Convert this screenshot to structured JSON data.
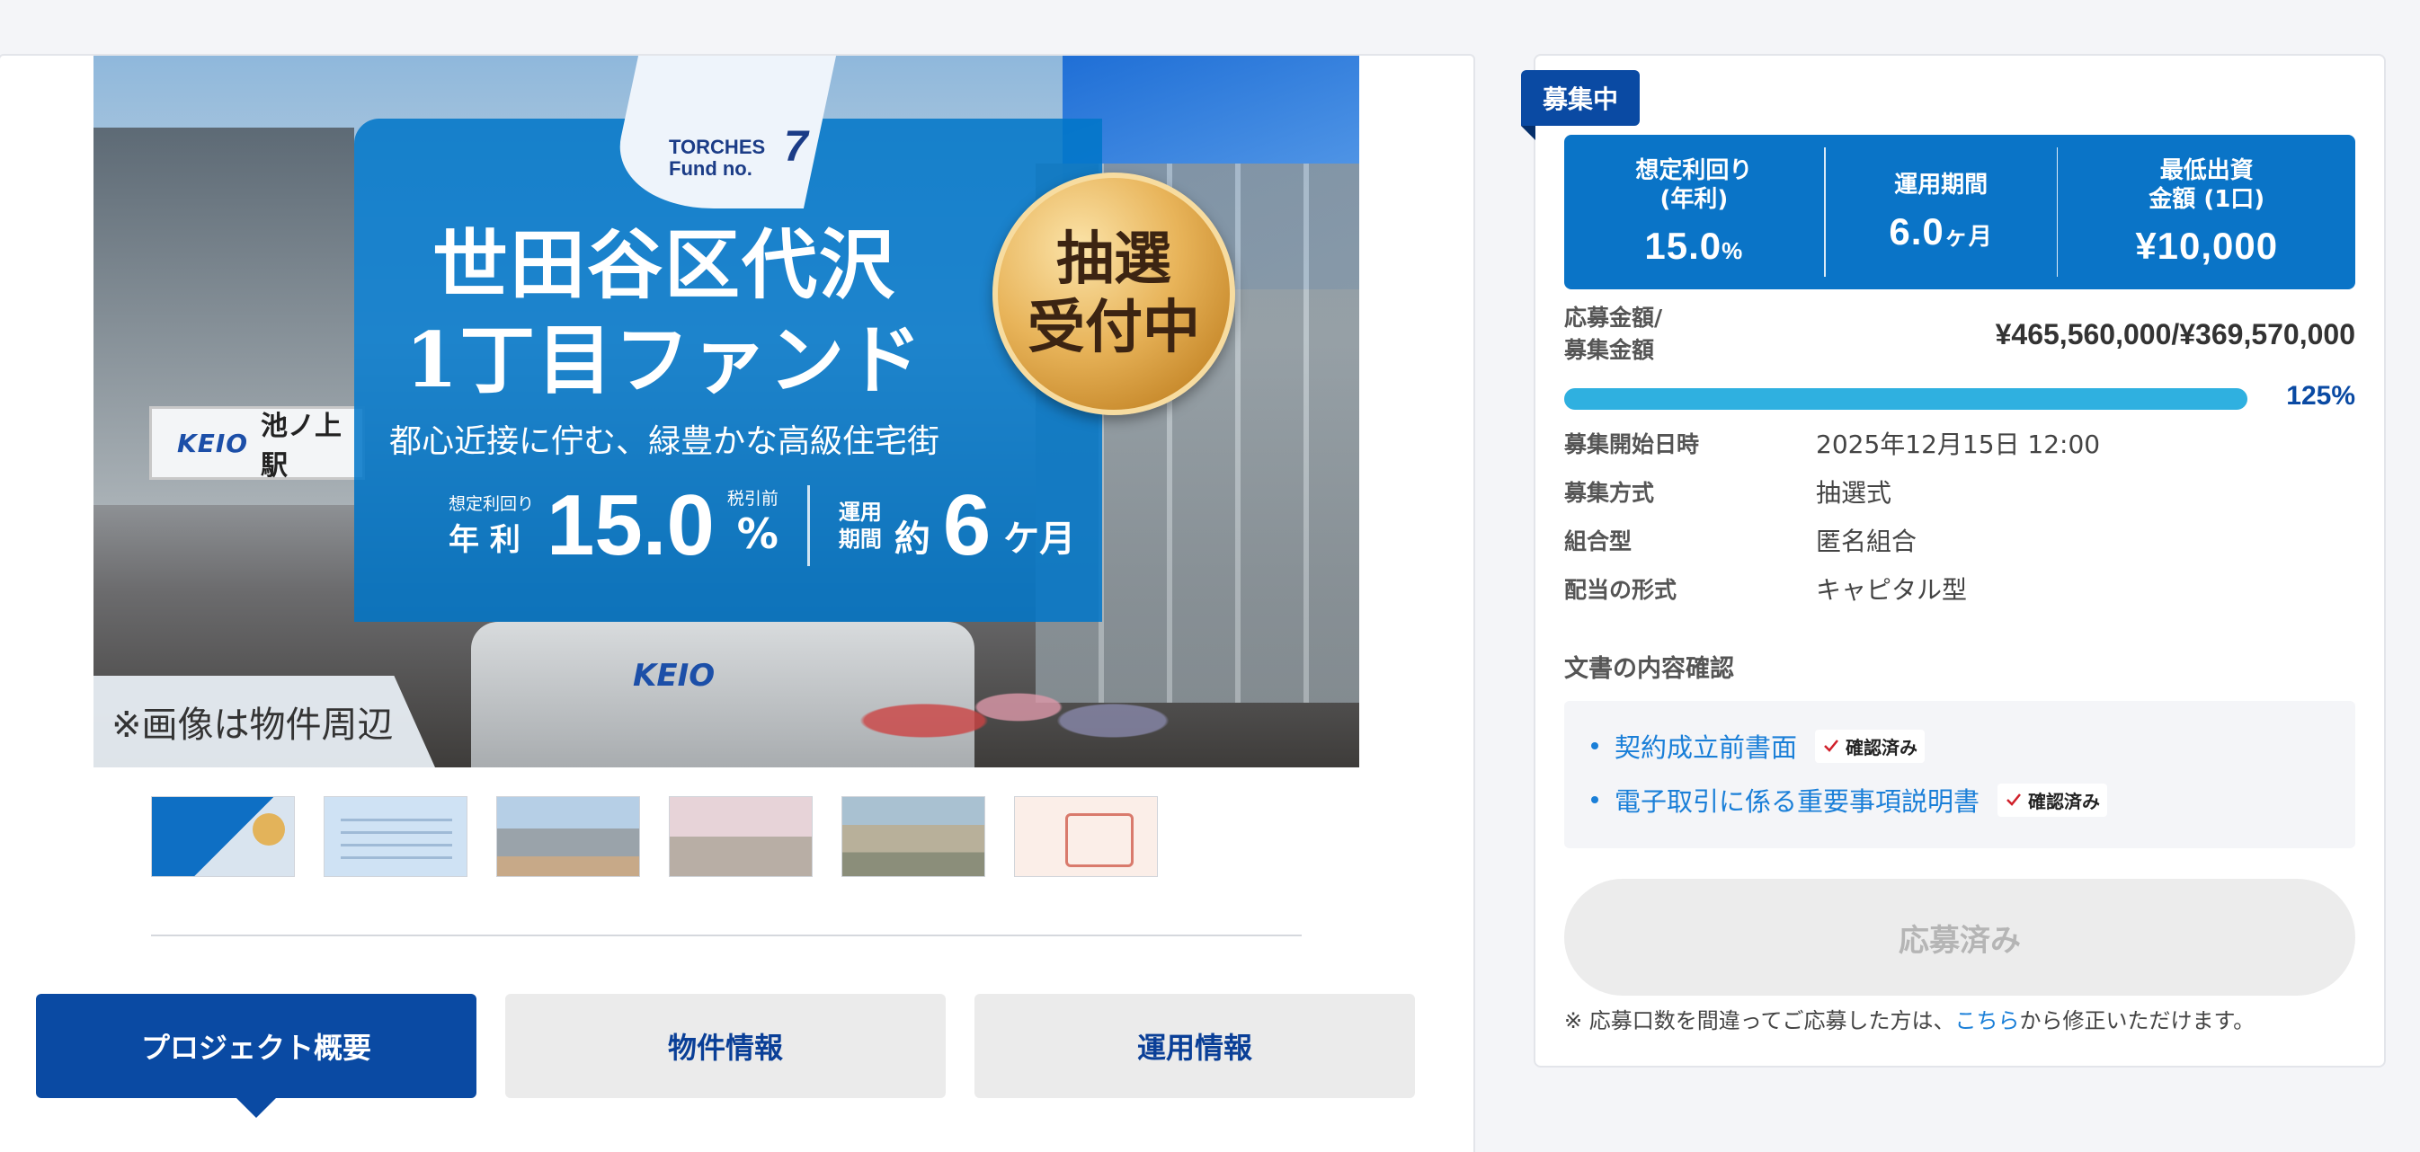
{
  "hero": {
    "fund_label_line1": "TORCHES",
    "fund_label_line2": "Fund no.",
    "fund_number": "7",
    "title_line1": "世田谷区代沢",
    "title_line2": "1丁目ファンド",
    "subtitle": "都心近接に佇む、緑豊かな高級住宅街",
    "stat1_small_label": "想定利回り",
    "stat1_big_label": "年 利",
    "stat1_value": "15.0",
    "stat1_tax_label": "税引前",
    "stat1_unit": "%",
    "stat2_label_line1": "運用",
    "stat2_label_line2": "期間",
    "stat2_prefix": "約",
    "stat2_value": "6",
    "stat2_unit": "ケ月",
    "seal_text": "抽選\n受付中",
    "station_logo": "KEIO",
    "station_name": "池ノ上駅",
    "train_logo": "KEIO",
    "caption": "※画像は物件周辺"
  },
  "thumbnails": [
    "thumb-1",
    "thumb-2",
    "thumb-3",
    "thumb-4",
    "thumb-5",
    "thumb-6"
  ],
  "tabs": [
    {
      "label": "プロジェクト概要",
      "active": true
    },
    {
      "label": "物件情報",
      "active": false
    },
    {
      "label": "運用情報",
      "active": false
    }
  ],
  "side": {
    "status_badge": "募集中",
    "stats": [
      {
        "label": "想定利回り\n(年利)",
        "value": "15.0",
        "unit": "%"
      },
      {
        "label": "運用期間",
        "value": "6.0",
        "unit": "ヶ月"
      },
      {
        "label": "最低出資\n金額 (1口)",
        "value": "¥10,000",
        "unit": ""
      }
    ],
    "amount_label": "応募金額/\n募集金額",
    "amount_value": "¥465,560,000/¥369,570,000",
    "progress_percent": 125,
    "progress_label": "125%",
    "info": [
      {
        "key": "募集開始日時",
        "value": "2025年12月15日 12:00"
      },
      {
        "key": "募集方式",
        "value": "抽選式"
      },
      {
        "key": "組合型",
        "value": "匿名組合"
      },
      {
        "key": "配当の形式",
        "value": "キャピタル型"
      }
    ],
    "docs_title": "文書の内容確認",
    "docs": [
      {
        "label": "契約成立前書面",
        "status": "確認済み"
      },
      {
        "label": "電子取引に係る重要事項説明書",
        "status": "確認済み"
      }
    ],
    "apply_button": "応募済み",
    "notice_prefix": "※ 応募口数を間違ってご応募した方は、",
    "notice_link": "こちら",
    "notice_suffix": "から修正いただけます。"
  },
  "colors": {
    "brand_blue": "#0a4aa3",
    "stat_blue": "#0a74c7",
    "progress": "#2fb0e0",
    "link": "#1a7fd8"
  }
}
